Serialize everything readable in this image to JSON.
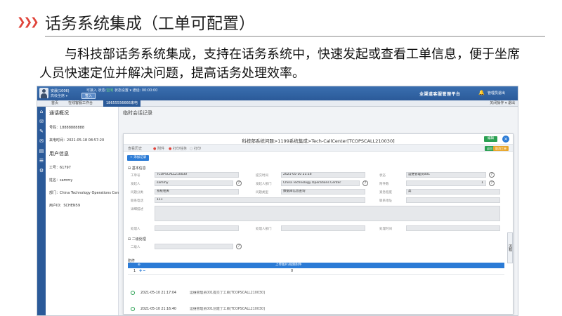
{
  "slide": {
    "title": "话务系统集成（工单可配置）",
    "description": "与科技部话务系统集成，支持在话务系统中，快速发起或查看工单信息，便于坐席人员快速定位并解决问题，提高话务处理效率。",
    "accent": "#e0443a"
  },
  "app": {
    "topbar": {
      "user_name": "安晨(1006)",
      "user_status": "高级坐席 ▾",
      "status_strip_pre": "可接入  状态:",
      "status_ok": "空闲",
      "status_strip_post": "  状态设置 ▾  通话: 00:00:00",
      "join_button": "签入",
      "brand": "全渠道客服管理平台",
      "logout": "管理员退出"
    },
    "tabs": [
      {
        "label": "首页"
      },
      {
        "label": "在线客服工作台"
      },
      {
        "label": "18655556666来电"
      }
    ],
    "tabbar_right": "关闭操作 ▾   退出",
    "rail_icons": [
      "home-icon",
      "chat-icon",
      "edit-icon",
      "mail-icon",
      "inbox-icon",
      "list-icon",
      "settings-icon"
    ],
    "left_panel": {
      "call_title": "通话概况",
      "caller_label": "号码：",
      "caller_value": "18888888888",
      "call_time_label": "来电时间：",
      "call_time_value": "2021-05-18 08:57:20",
      "user_title": "用户信息",
      "user_fields": [
        {
          "label": "工号：",
          "value": "61797"
        },
        {
          "label": "姓名：",
          "value": "sammy"
        },
        {
          "label": "部门：",
          "value": "China Technology Operations Center"
        },
        {
          "label": "用户ID：",
          "value": "SCHEN59"
        }
      ]
    },
    "main": {
      "title": "临时会话记录",
      "dialog": {
        "title": "科技部系统问题>1199系统集成>Tech-CallCenter[TCOPSCALL210030]",
        "green_button": "编辑",
        "close": "×",
        "toolbar": [
          "查看历史",
          "附件",
          "打印任务",
          "打印"
        ],
        "mini_buttons": [
          "返回",
          "取消工单"
        ],
        "add_button": "+ 添加记录",
        "basic_section": "⊟ 基本信息",
        "fields": [
          {
            "label": "工单号",
            "value": "TCOPSCALL210030"
          },
          {
            "label": "提交时间",
            "value": "2021-05-10 21:16"
          },
          {
            "label": "状态",
            "value": ""
          },
          {
            "label": "处理人",
            "value": "运维管理员001"
          },
          {
            "label": "发起人",
            "value": "sammy"
          },
          {
            "label": "发起人部门",
            "value": "China Technology Operations Center"
          },
          {
            "label": "附件数",
            "value": ""
          },
          {
            "label": "附件值",
            "value": "1"
          },
          {
            "label": "问题分类",
            "value": "系统相关"
          },
          {
            "label": "问题类型",
            "value": "数据库信息查询"
          },
          {
            "label": "紧急程度",
            "value": "高"
          },
          {
            "label": "联系电话",
            "value": "111"
          },
          {
            "label": "联系地址",
            "value": ""
          },
          {
            "label": "详细描述",
            "value": ""
          },
          {
            "label": "处理人",
            "value": ""
          },
          {
            "label": "处理人部门",
            "value": ""
          },
          {
            "label": "处理时间",
            "value": ""
          }
        ],
        "second_section": "⊟ 二级处理",
        "second_label": "二级人",
        "attach_label": "附件",
        "attach_header": "上传图片/视频附件",
        "attach_row_num": "1",
        "attach_row_value": "0",
        "timeline": [
          {
            "time": "2021-05-10 21:17:04",
            "text": "运维管理员001提交了工单[TCOPSCALL210030]"
          },
          {
            "time": "2021-05-10 21:16:40",
            "text": "运维管理员001创建了工单[TCOPSCALL210030]"
          }
        ],
        "side_tab": "流程"
      }
    }
  },
  "colors": {
    "topbar": "#2b5a99",
    "primary_blue": "#2b7bd6",
    "green": "#2aa052",
    "status_ok": "#6fe07a"
  }
}
